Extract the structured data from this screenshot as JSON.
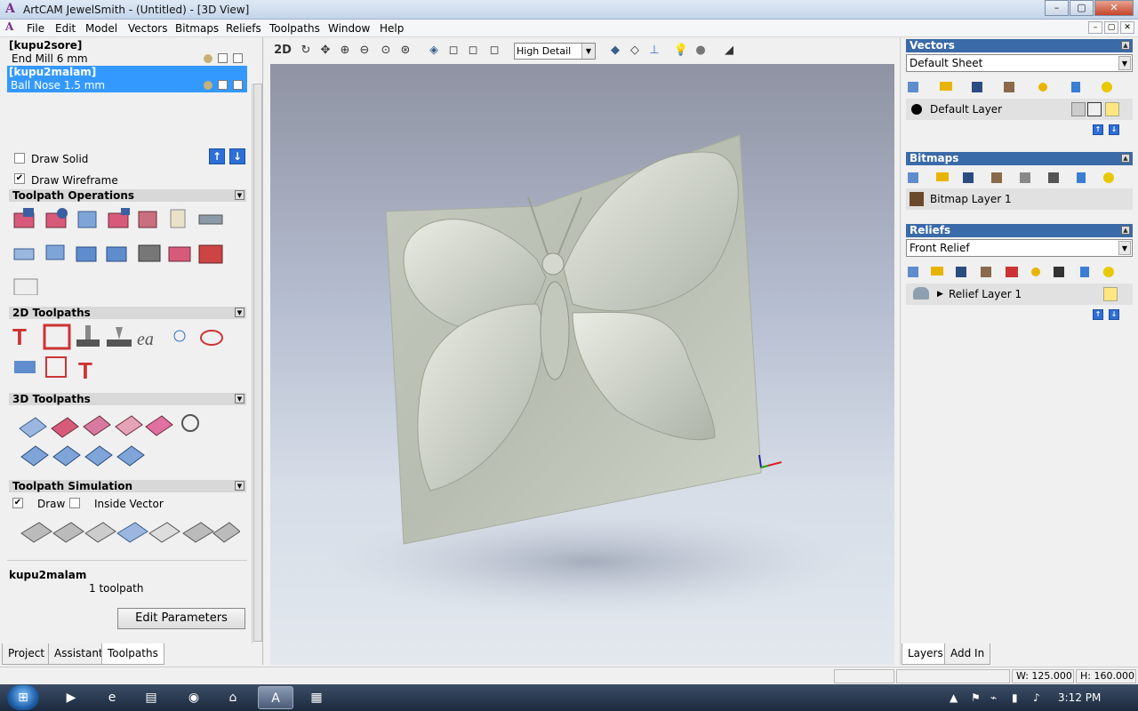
{
  "window": {
    "app_icon": "artcam-logo-icon",
    "title": "ArtCAM JewelSmith - (Untitled) - [3D View]",
    "minimize": "–",
    "maximize": "▢",
    "close": "✕"
  },
  "menu": {
    "items": [
      "File",
      "Edit",
      "Model",
      "Vectors",
      "Bitmaps",
      "Reliefs",
      "Toolpaths",
      "Window",
      "Help"
    ],
    "mdi_buttons": [
      "–",
      "▢",
      "✕"
    ]
  },
  "toolpaths_panel": {
    "groups": [
      {
        "name": "[kupu2sore]",
        "tool": "End Mill 6 mm",
        "selected": false
      },
      {
        "name": "[kupu2malam]",
        "tool": "Ball Nose 1.5 mm",
        "selected": true
      }
    ],
    "draw_solid": {
      "label": "Draw Solid",
      "checked": false
    },
    "draw_wireframe": {
      "label": "Draw Wireframe",
      "checked": true
    },
    "sections": {
      "toolpath_operations": "Toolpath Operations",
      "toolpaths_2d": "2D Toolpaths",
      "toolpaths_3d": "3D Toolpaths",
      "simulation": "Toolpath Simulation"
    },
    "sim_draw": {
      "label": "Draw",
      "checked": true
    },
    "sim_inside_vector": {
      "label": "Inside Vector",
      "checked": false
    },
    "selected_name": "kupu2malam",
    "selected_info": "1 toolpath",
    "edit_button": "Edit Parameters"
  },
  "left_tabs": [
    "Project",
    "Assistant",
    "Toolpaths"
  ],
  "view_toolbar": {
    "mode_label": "2D",
    "detail_value": "High Detail"
  },
  "right_panel": {
    "vectors": {
      "title": "Vectors",
      "sheet": "Default Sheet",
      "layer": "Default Layer"
    },
    "bitmaps": {
      "title": "Bitmaps",
      "layer": "Bitmap Layer 1"
    },
    "reliefs": {
      "title": "Reliefs",
      "relief": "Front Relief",
      "layer": "Relief Layer 1"
    }
  },
  "right_tabs": [
    "Layers",
    "Add In"
  ],
  "status": {
    "width": "W: 125.000",
    "height": "H: 160.000"
  },
  "taskbar": {
    "clock": "3:12 PM",
    "start_glyph": "⊞"
  },
  "colors": {
    "accent": "#3399ff",
    "panel_header": "#3a6aa8",
    "relief_surface": "#c9cfc3"
  }
}
